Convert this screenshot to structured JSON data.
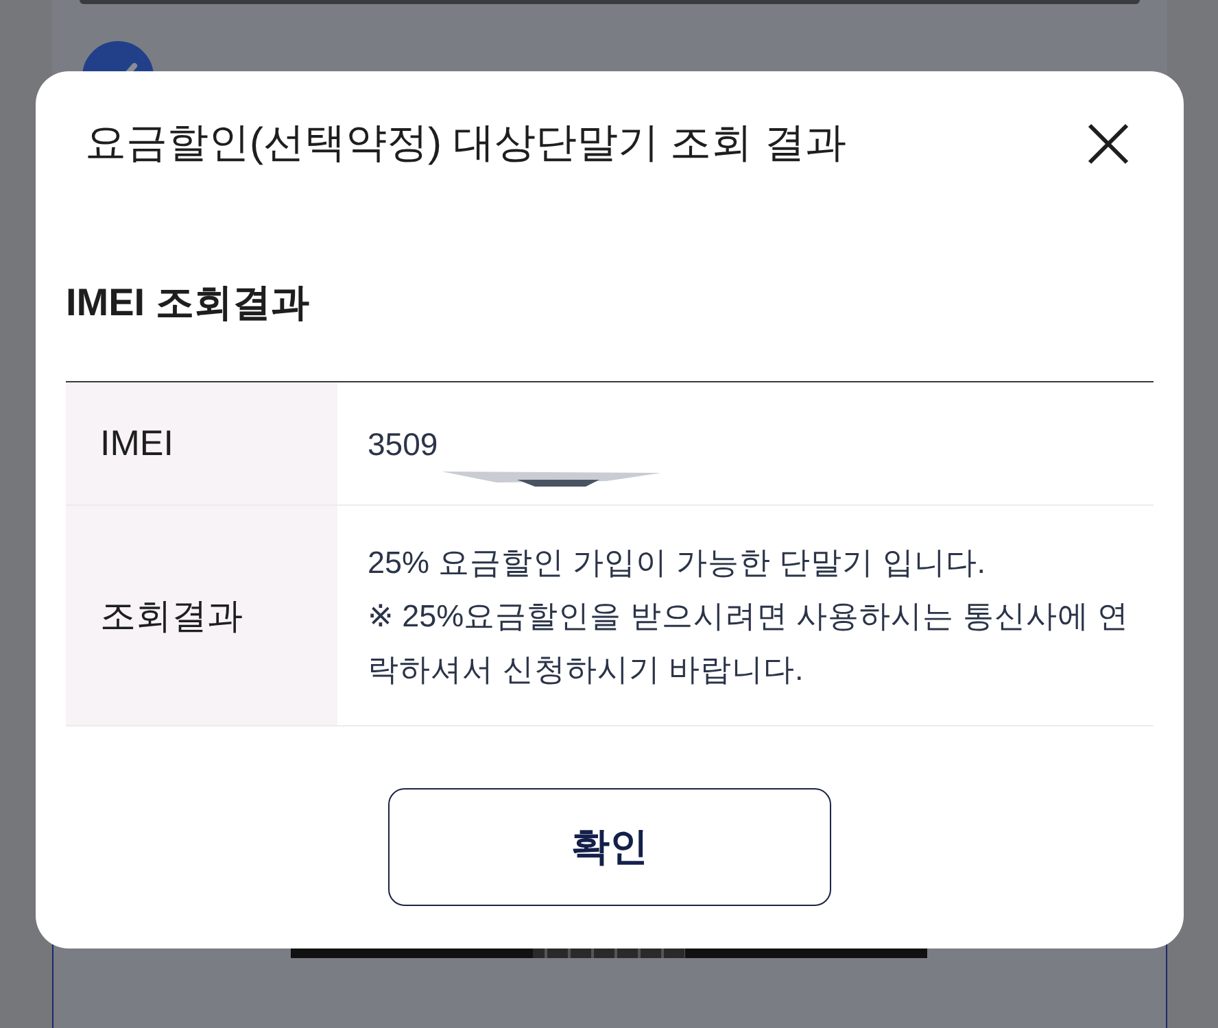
{
  "background": {
    "consent_checked": true
  },
  "dialog": {
    "title": "요금할인(선택약정) 대상단말기 조회 결과",
    "section_title": "IMEI 조회결과",
    "rows": [
      {
        "kind": "value",
        "label": "IMEI",
        "value": "3509",
        "redacted": true
      },
      {
        "kind": "message",
        "label": "조회결과",
        "message": "25% 요금할인 가입이 가능한 단말기 입니다.",
        "notice": [
          "※ 25%요금할인을 받으시려면 사용하시는 통신사에 연",
          "락하셔서 신청하시기 바랍니다."
        ]
      }
    ],
    "confirm_button": "확인"
  }
}
